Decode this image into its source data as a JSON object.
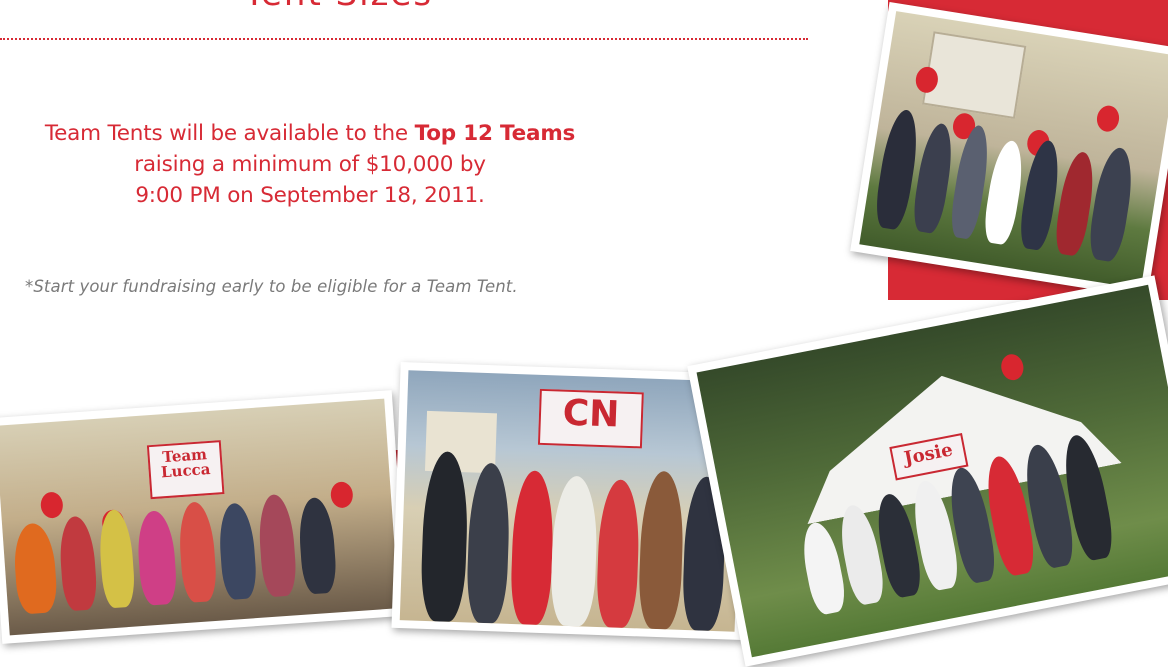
{
  "heading_fragment": "Tent Sizes",
  "promo": {
    "part1": "Team Tents will be available to the ",
    "highlight": "Top 12 Teams",
    "line2": "raising a minimum of $10,000 by",
    "line3": "9:00 PM on September 18, 2011."
  },
  "footnote": "*Start your fundraising early to be eligible for a Team Tent.",
  "photos": {
    "team_lucca_sign": [
      "Team",
      "Lucca"
    ],
    "cn_sign": "CN",
    "josie_sign": "Josie"
  },
  "colors": {
    "brand_red": "#d72a35",
    "footnote_gray": "#7a7a7a"
  }
}
